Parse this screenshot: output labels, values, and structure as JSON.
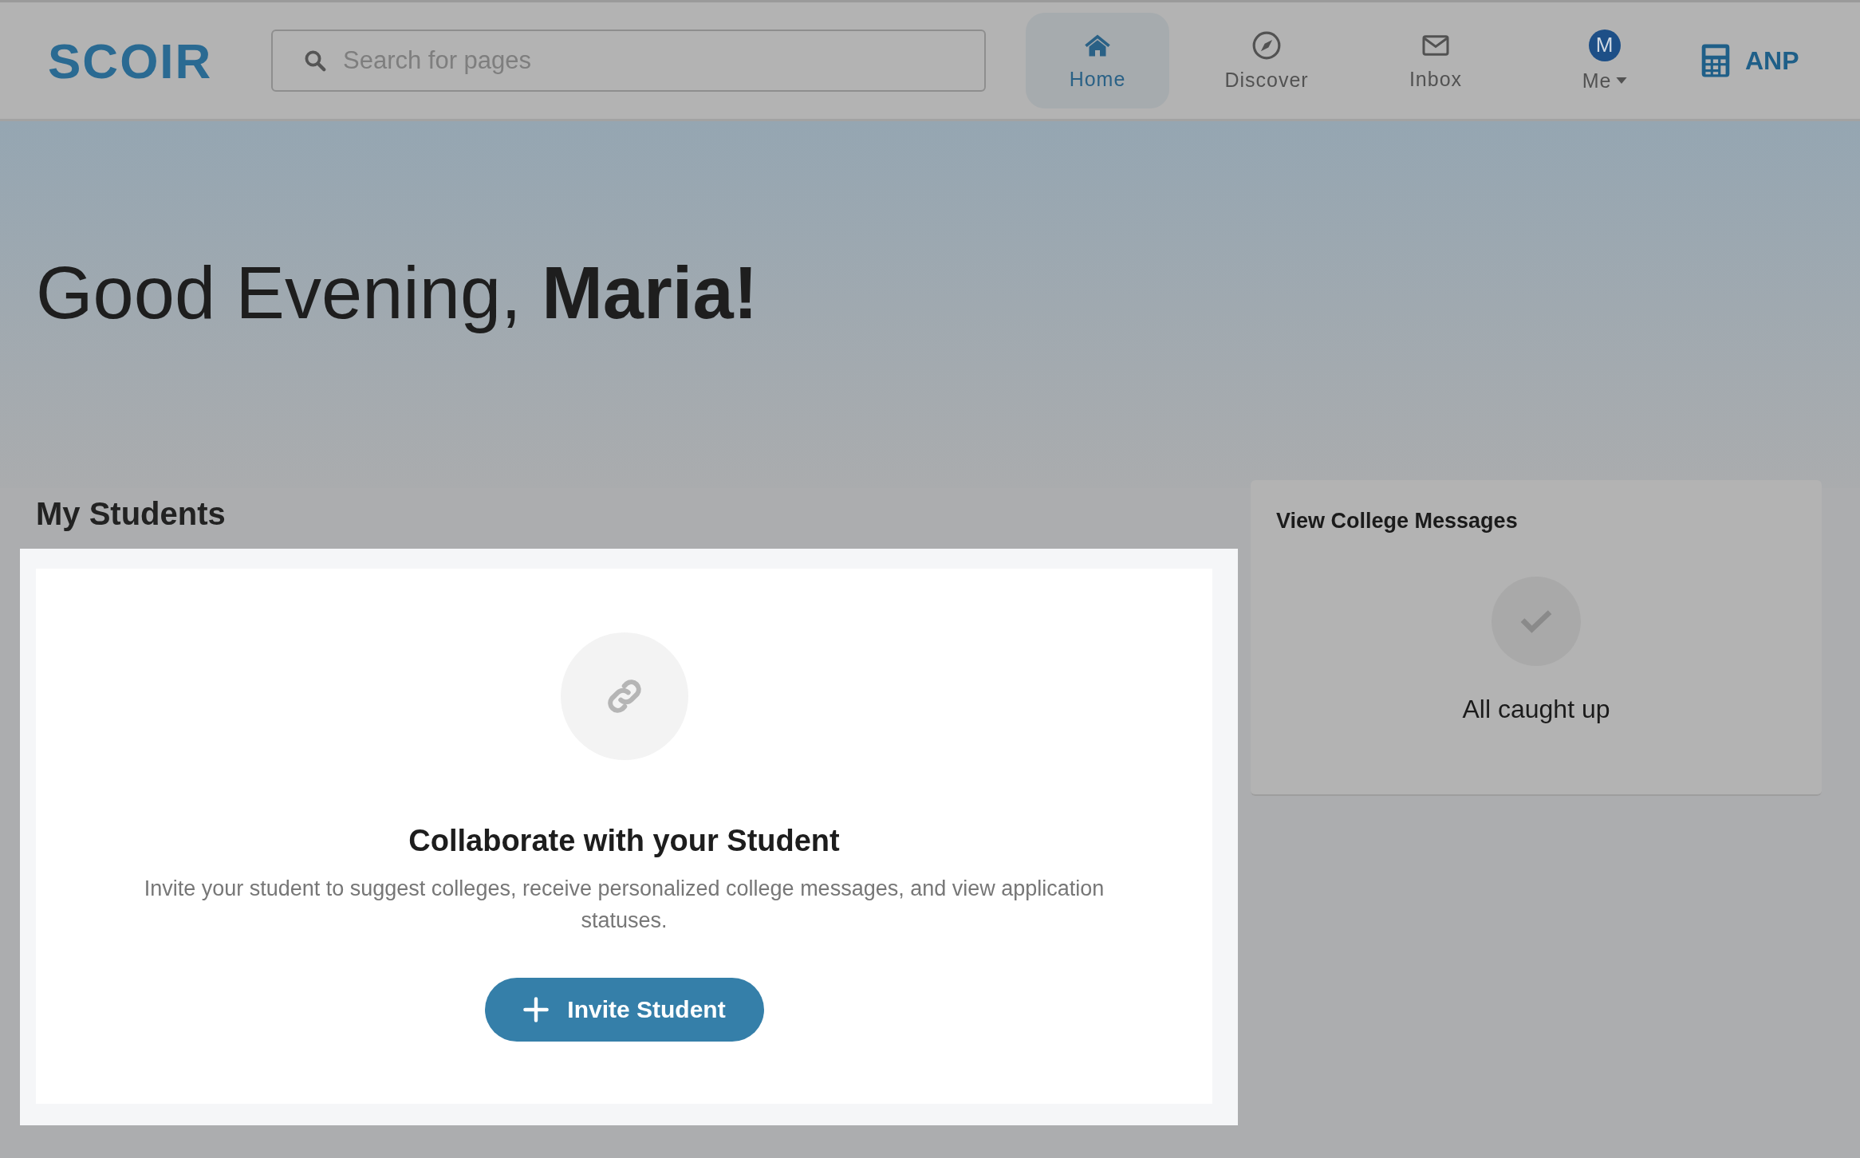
{
  "header": {
    "logo": "SCOIR",
    "search": {
      "placeholder": "Search for pages"
    },
    "nav": [
      {
        "kind": "home",
        "label": "Home",
        "selected": true
      },
      {
        "kind": "discover",
        "label": "Discover",
        "selected": false
      },
      {
        "kind": "inbox",
        "label": "Inbox",
        "selected": false
      },
      {
        "kind": "me",
        "label": "Me",
        "avatar": "M",
        "selected": false
      }
    ],
    "calculator": {
      "label": "ANP"
    }
  },
  "greeting": "Good Evening, **Maria!**",
  "students": {
    "title": "My Students",
    "card": {
      "heading": "Collaborate with your Student",
      "text": "Invite your student to suggest colleges, receive personalized college messages, and view application statuses.",
      "button": "Invite Student"
    }
  },
  "messages": {
    "title": "View College Messages",
    "status": "All caught up"
  }
}
